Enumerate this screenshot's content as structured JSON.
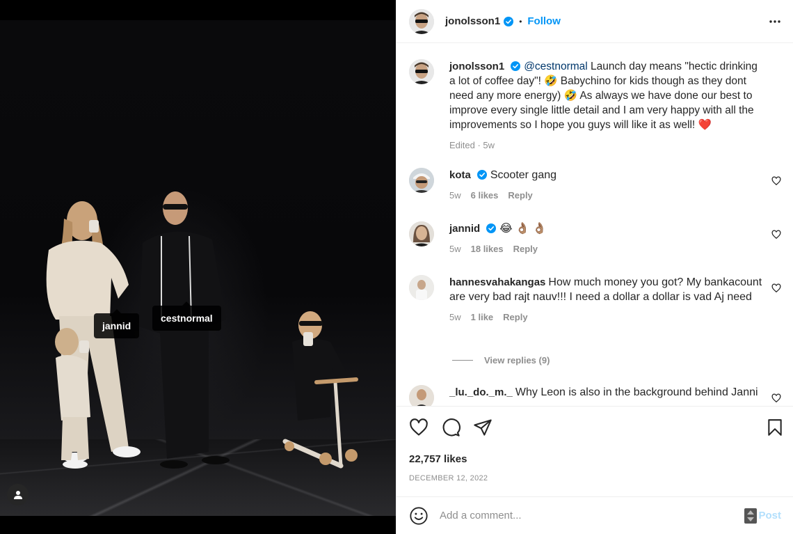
{
  "post": {
    "author": "jonolsson1",
    "follow_label": "Follow",
    "separator": "•",
    "tags": [
      "jannid",
      "cestnormal"
    ]
  },
  "caption": {
    "username": "jonolsson1",
    "mention": "@cestnormal",
    "text": " Launch day means \"hectic drinking a lot of coffee day\"! 🤣 Babychino for kids though as they dont need any more energy) 🤣 As always we have done our best to improve every single little detail and I am very happy with all the improvements so I hope you guys will like it as well! ❤️",
    "meta": "Edited · 5w"
  },
  "comments": [
    {
      "username": "kota",
      "verified": true,
      "text": "Scooter gang",
      "time": "5w",
      "likes": "6 likes",
      "reply": "Reply"
    },
    {
      "username": "jannid",
      "verified": true,
      "text": "😂 👌🏽 👌🏽",
      "time": "5w",
      "likes": "18 likes",
      "reply": "Reply"
    },
    {
      "username": "hannesvahakangas",
      "verified": false,
      "text": "How much money you got? My bankacount are very bad rajt nauv!!! I need a dollar a dollar is vad Aj need",
      "time": "5w",
      "likes": "1 like",
      "reply": "Reply"
    },
    {
      "username": "_lu._do._m._",
      "verified": false,
      "text": "Why Leon is also in the background behind Janni"
    }
  ],
  "view_replies": "View replies (9)",
  "likes": "22,757 likes",
  "date": "DECEMBER 12, 2022",
  "comment_box": {
    "placeholder": "Add a comment...",
    "post_label": "Post"
  },
  "colors": {
    "accent": "#0095f6",
    "verified": "#0095f6",
    "muted": "#8e8e8e",
    "heart": "#ed4956"
  }
}
